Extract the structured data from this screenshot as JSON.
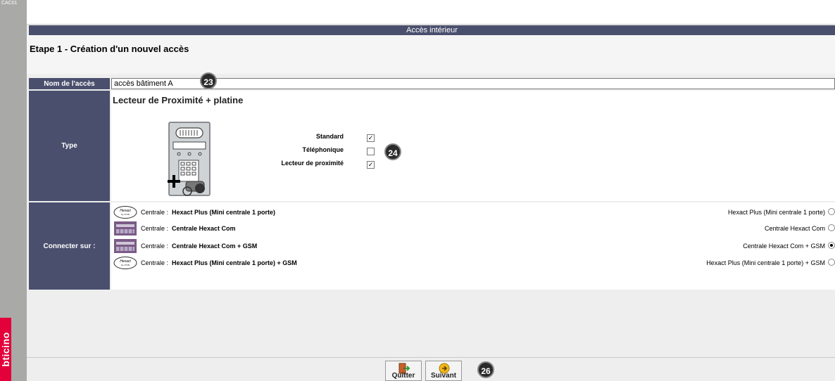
{
  "window": {
    "corner_label": "CAC01"
  },
  "brand": {
    "text": "bticino",
    "color": "#e4003a"
  },
  "header": {
    "title": "Accès intérieur"
  },
  "step": {
    "title": "Etape 1 - Création d'un nouvel accès"
  },
  "form": {
    "name_label": "Nom de l'accès",
    "name_value": "accès bâtiment A",
    "type_label": "Type",
    "type_title": "Lecteur de Proximité + platine",
    "options": [
      {
        "label": "Standard",
        "checked": true
      },
      {
        "label": "Téléphonique",
        "checked": false
      },
      {
        "label": "Lecteur de proximité",
        "checked": true
      }
    ],
    "connect_label": "Connecter sur :",
    "centrales": [
      {
        "prefix": "Centrale :",
        "name": "Hexact Plus (Mini centrale 1 porte)",
        "right": "Hexact Plus (Mini centrale 1 porte)",
        "logo": "hexact-logo",
        "selected": false
      },
      {
        "prefix": "Centrale :",
        "name": "Centrale Hexact Com",
        "right": "Centrale Hexact Com",
        "logo": "hexact-com-logo",
        "selected": false
      },
      {
        "prefix": "Centrale :",
        "name": "Centrale Hexact Com + GSM",
        "right": "Centrale Hexact Com + GSM",
        "logo": "hexact-com-logo",
        "selected": true
      },
      {
        "prefix": "Centrale :",
        "name": "Hexact Plus (Mini centrale 1 porte) + GSM",
        "right": "Hexact Plus (Mini centrale 1 porte) + GSM",
        "logo": "hexact-logo",
        "selected": false
      }
    ]
  },
  "callouts": {
    "c23": "23",
    "c24": "24",
    "c26": "26"
  },
  "buttons": {
    "quit": "Quitter",
    "next": "Suivant"
  },
  "colors": {
    "header_bg": "#4a4f6d",
    "sidebar_bg": "#a9a9a7"
  }
}
